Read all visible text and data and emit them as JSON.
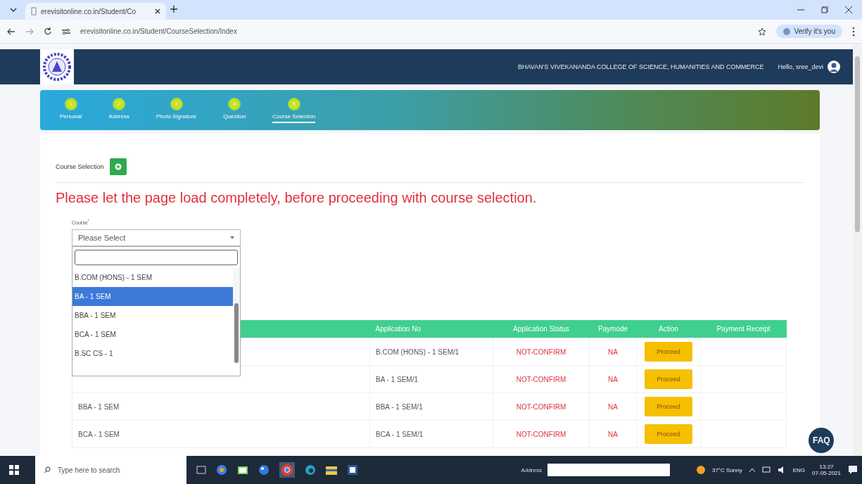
{
  "browser": {
    "tab_title": "erevisitonline.co.in/Student/Co",
    "url": "erevisitonline.co.in/Student/CourseSelection/Index",
    "profile_chip": "Verify it's you"
  },
  "site": {
    "college_name": "BHAVAN'S VIVEKANANDA COLLEGE OF SCIENCE, HUMANITIES AND COMMERCE",
    "greeting": "Hello, sree_devi"
  },
  "steps": [
    {
      "number": "1",
      "label": "Personal",
      "selected": false
    },
    {
      "number": "2",
      "label": "Address",
      "selected": false
    },
    {
      "number": "3",
      "label": "Photo Signature",
      "selected": false
    },
    {
      "number": "4",
      "label": "Question",
      "selected": false
    },
    {
      "number": "5",
      "label": "Course Selection",
      "selected": true
    }
  ],
  "section": {
    "title": "Course Selection"
  },
  "notice": "Please let the page load completely, before proceeding with course selection.",
  "course_field": {
    "label": "Course",
    "required_mark": "*",
    "value": "Please Select",
    "expanded": true,
    "options": [
      {
        "label": "B.COM (HONS) - 1 SEM",
        "selected": false
      },
      {
        "label": "BA - 1 SEM",
        "selected": true
      },
      {
        "label": "BBA - 1 SEM",
        "selected": false
      },
      {
        "label": "BCA - 1 SEM",
        "selected": false
      },
      {
        "label": "B.SC CS - 1",
        "selected": false
      }
    ]
  },
  "table": {
    "columns": [
      "Application No",
      "Application Status",
      "Paymode",
      "Action",
      "Payment Receipt"
    ],
    "rows": [
      {
        "application_no": "B.COM (HONS) - 1 SEM/1",
        "status": "NOT-CONFIRM",
        "paymode": "NA",
        "action": "Proceed"
      },
      {
        "application_no": "BA - 1 SEM/1",
        "status": "NOT-CONFIRM",
        "paymode": "NA",
        "action": "Proceed"
      },
      {
        "course": "BBA - 1 SEM",
        "application_no": "BBA - 1 SEM/1",
        "status": "NOT-CONFIRM",
        "paymode": "NA",
        "action": "Proceed"
      },
      {
        "course": "BCA - 1 SEM",
        "application_no": "BCA - 1 SEM/1",
        "status": "NOT-CONFIRM",
        "paymode": "NA",
        "action": "Proceed"
      }
    ]
  },
  "faq": "FAQ",
  "taskbar": {
    "search_placeholder": "Type here to search",
    "address_label": "Address",
    "weather": "37°C Sunny",
    "language": "ENG",
    "time": "13:27",
    "date": "07-05-2021"
  }
}
